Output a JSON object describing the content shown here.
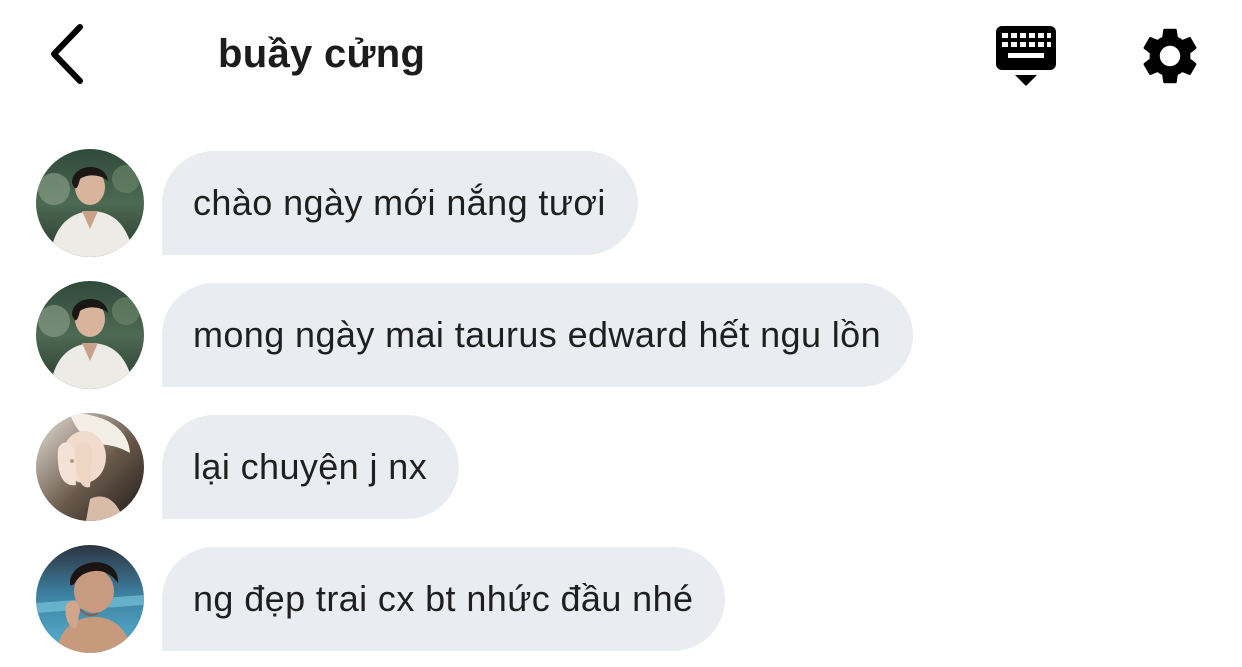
{
  "header": {
    "title": "buầy cửng",
    "back_icon": "chevron-left-icon",
    "keyboard_icon": "keyboard-icon",
    "settings_icon": "gear-icon"
  },
  "messages": [
    {
      "text": "chào ngày mới nắng tươi",
      "avatar": "avatar-man-white-shirt"
    },
    {
      "text": "mong ngày mai taurus edward hết ngu lồn",
      "avatar": "avatar-man-white-shirt"
    },
    {
      "text": "lại chuyện j nx",
      "avatar": "avatar-blonde-hands-face"
    },
    {
      "text": "ng đẹp trai cx bt nhức đầu nhé",
      "avatar": "avatar-man-pool"
    }
  ],
  "colors": {
    "bubble": "#e9edf2",
    "text": "#1f1f1f",
    "icon": "#000000"
  }
}
